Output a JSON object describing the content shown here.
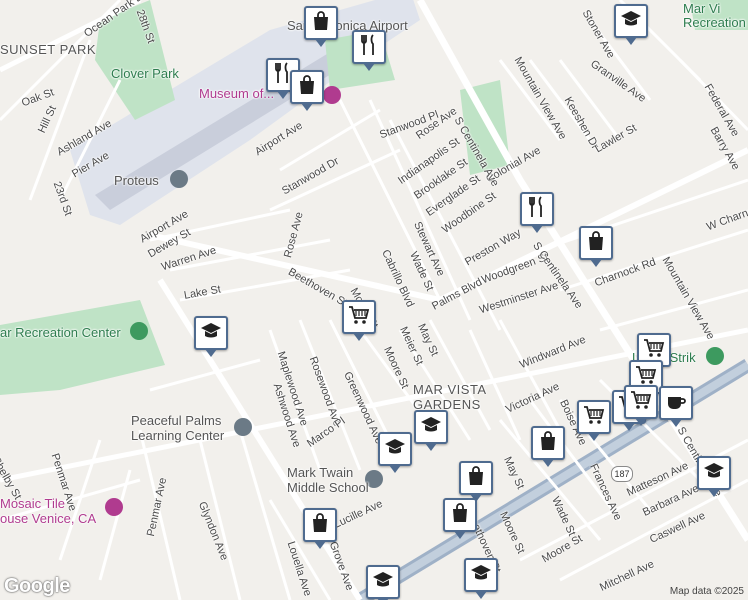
{
  "map": {
    "attribution": "Map data ©2025",
    "logo": "Google",
    "route_shield": "187"
  },
  "places": {
    "santa_monica_airport": "Santa Monica Airport",
    "museum": "Museum of...",
    "clover_park": "Clover Park",
    "proteus": "Proteus",
    "recreation_center_left": "ar Recreation Center",
    "peaceful_palms": "Peaceful Palms\nLearning Center",
    "mosaic_tile": "Mosaic Tile\nouse Venice, CA",
    "mark_twain": "Mark Twain\nMiddle School",
    "lucky_strike": "Lucky Strik",
    "mar_vista_rec": "Mar Vi\nRecreation Cen",
    "mar_vista_area": "MAR VISTA\nGARDENS",
    "sunset_park": "SUNSET PARK"
  },
  "streets": [
    "Ocean Park Blvd",
    "28th St",
    "Oak St",
    "Hill St",
    "Ashland Ave",
    "Pier Ave",
    "23rd St",
    "Airport Ave",
    "Dewey St",
    "Warren Ave",
    "Lake St",
    "Penmar Ave",
    "Stanwood Dr",
    "Stanwood Pl",
    "Rose Ave",
    "Indianapolis St",
    "Brooklake St",
    "Everglade St",
    "Woodbine St",
    "Stewart Ave",
    "Wade St",
    "Cabrillo Blvd",
    "Palms Blvd",
    "Beethoven St",
    "Moore St",
    "Meier St",
    "May St",
    "Preston Way",
    "Colonial Ave",
    "Woodgreen St",
    "Westminster Ave",
    "S Centinela Ave",
    "Mountain View Ave",
    "Keeshen Dr",
    "Lawler St",
    "Granville Ave",
    "Stoner Ave",
    "Federal Ave",
    "Barry Ave",
    "W Charnock Rd",
    "Charnock Rd",
    "Windward Ave",
    "Victoria Ave",
    "Maplewood Ave",
    "Ashwood Ave",
    "Rosewood Ave",
    "Greenwood Ave",
    "Marco Pl",
    "Glyndon Ave",
    "Louella Ave",
    "Grove Ave",
    "Lucille Ave",
    "Caswell Ave",
    "Mitchell Ave",
    "Matteson Ave",
    "Barbara Ave",
    "Frances Ave",
    "Boise Ave",
    "Shelby St",
    "Ozone Ave"
  ],
  "markers": [
    {
      "type": "shopping-bag"
    },
    {
      "type": "restaurant"
    },
    {
      "type": "restaurant"
    },
    {
      "type": "shopping-bag"
    },
    {
      "type": "school"
    },
    {
      "type": "school"
    },
    {
      "type": "grocery-cart"
    },
    {
      "type": "restaurant"
    },
    {
      "type": "shopping-bag"
    },
    {
      "type": "grocery-cart"
    },
    {
      "type": "school"
    },
    {
      "type": "school"
    },
    {
      "type": "shopping-bag"
    },
    {
      "type": "grocery-cart"
    },
    {
      "type": "grocery-cart"
    },
    {
      "type": "grocery-cart"
    },
    {
      "type": "coffee"
    },
    {
      "type": "grocery-cart"
    },
    {
      "type": "shopping-bag"
    },
    {
      "type": "shopping-bag"
    },
    {
      "type": "school"
    },
    {
      "type": "school"
    },
    {
      "type": "shopping-bag"
    },
    {
      "type": "school"
    }
  ]
}
